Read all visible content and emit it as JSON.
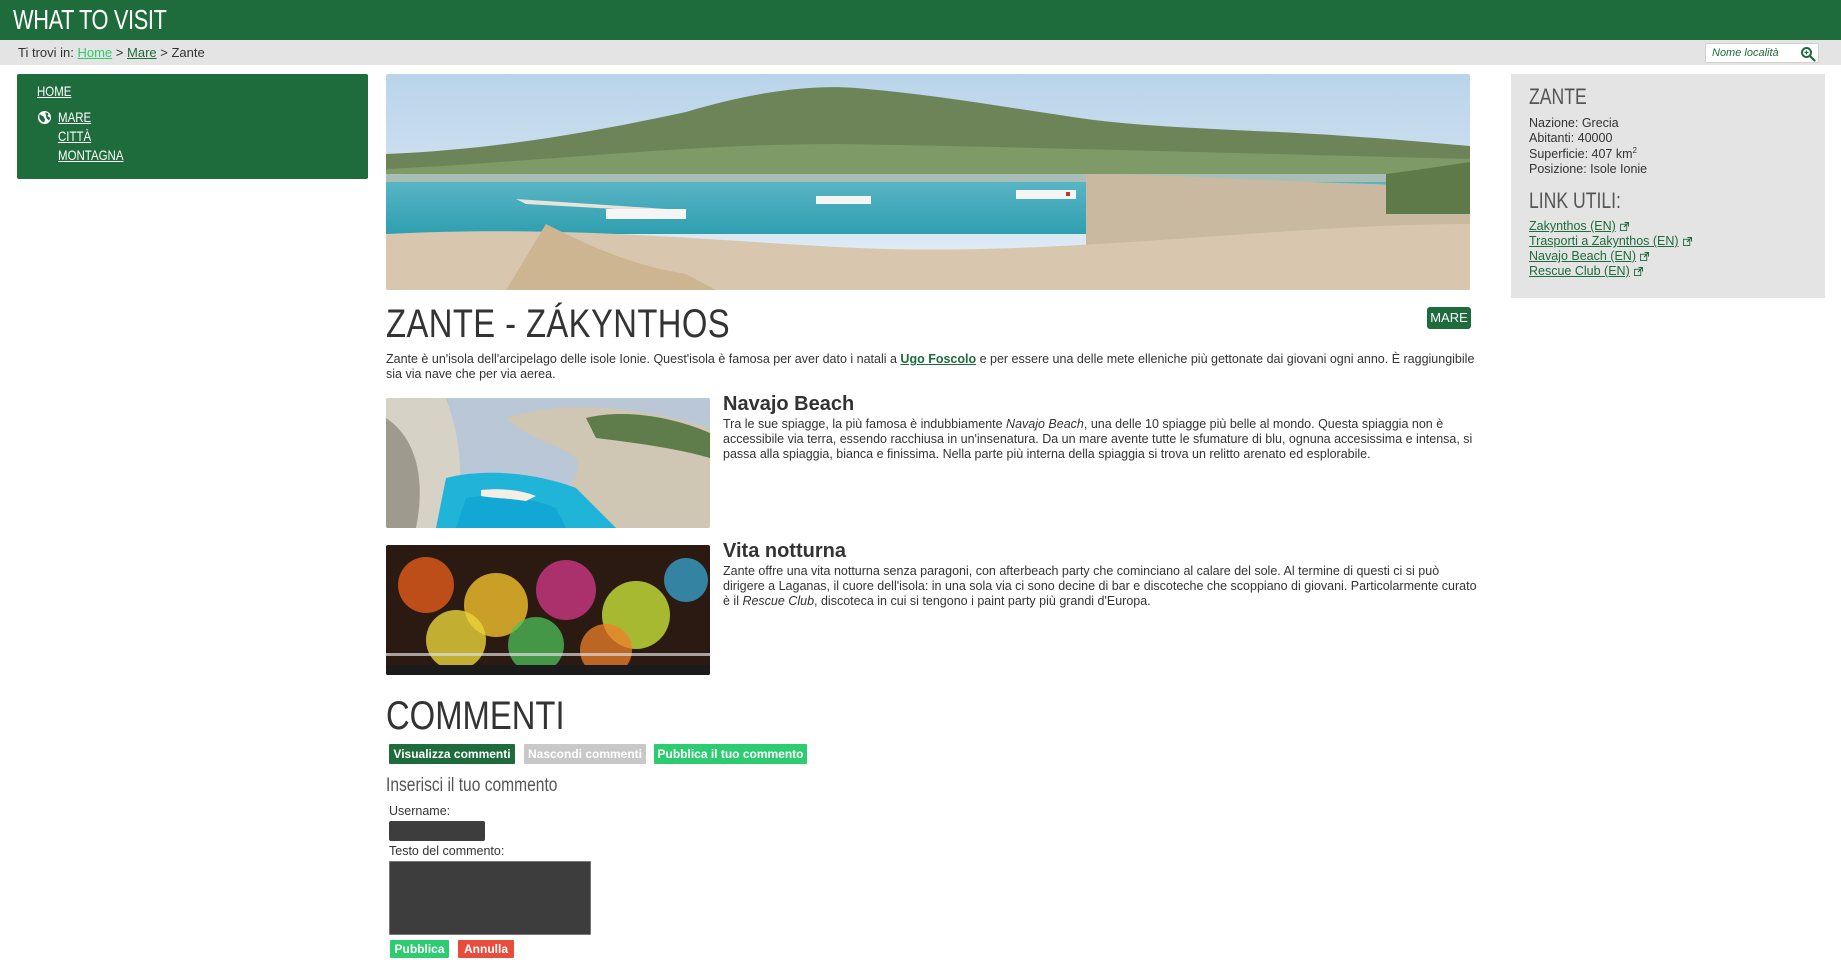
{
  "header": {
    "site_title": "WHAT TO VISIT"
  },
  "breadcrumb": {
    "prefix": "Ti trovi in:",
    "home": "Home",
    "sep1": ">",
    "mare": "Mare",
    "sep2": ">",
    "current": "Zante"
  },
  "search": {
    "placeholder": "Nome località",
    "icon": "search-icon"
  },
  "sidebar": {
    "items": [
      {
        "label": "HOME"
      },
      {
        "label": "MARE",
        "icon": "globe-icon"
      },
      {
        "label": "CITTÀ"
      },
      {
        "label": "MONTAGNA"
      }
    ]
  },
  "main": {
    "title": "ZANTE - ZÁKYNTHOS",
    "tag": "MARE",
    "intro_before": "Zante è un'isola dell'arcipelago delle isole Ionie. Quest'isola è famosa per aver dato i natali a ",
    "intro_link": "Ugo Foscolo",
    "intro_after": " e per essere una delle mete elleniche più gettonate dai giovani ogni anno. È raggiungibile sia via nave che per via aerea.",
    "sections": [
      {
        "title": "Navajo Beach",
        "text_1": "Tra le sue spiagge, la più famosa è indubbiamente ",
        "text_em": "Navajo Beach",
        "text_2": ", una delle 10 spiagge più belle al mondo. Questa spiaggia non è accessibile via terra, essendo racchiusa in un'insenatura. Da un mare avente tutte le sfumature di blu, ognuna accesissima e intensa, si passa alla spiaggia, bianca e finissima. Nella parte più interna della spiaggia si trova un relitto arenato ed esplorabile."
      },
      {
        "title": "Vita notturna",
        "text_1": "Zante offre una vita notturna senza paragoni, con afterbeach party che cominciano al calare del sole. Al termine di questi ci si può dirigere a Laganas, il cuore dell'isola: in una sola via ci sono decine di bar e discoteche che scoppiano di giovani. Particolarmente curato è il ",
        "text_em": "Rescue Club",
        "text_2": ", discoteca in cui si tengono i paint party più grandi d'Europa."
      }
    ]
  },
  "comments": {
    "title": "COMMENTI",
    "show_button": "Visualizza commenti",
    "hide_button": "Nascondi commenti",
    "publish_button": "Pubblica il tuo commento",
    "form_heading": "Inserisci il tuo commento",
    "username_label": "Username:",
    "text_label": "Testo del commento:",
    "submit_button": "Pubblica",
    "cancel_button": "Annulla"
  },
  "infobox": {
    "title": "ZANTE",
    "nation_label": "Nazione: ",
    "nation": "Grecia",
    "inhabitants_label": "Abitanti: ",
    "inhabitants": "40000",
    "area_label": "Superficie: ",
    "area": "407 km",
    "area_sup": "2",
    "position_label": "Posizione: ",
    "position": "Isole Ionie",
    "links_title": "LINK UTILI:",
    "links": [
      {
        "label": "Zakynthos (EN)"
      },
      {
        "label": "Trasporti a Zakynthos (EN)"
      },
      {
        "label": "Navajo Beach (EN)"
      },
      {
        "label": "Rescue Club (EN)"
      }
    ]
  },
  "colors": {
    "primary": "#1e6b3c",
    "accent": "#2ecc71",
    "danger": "#e74c3c",
    "panel": "#e4e4e4"
  }
}
